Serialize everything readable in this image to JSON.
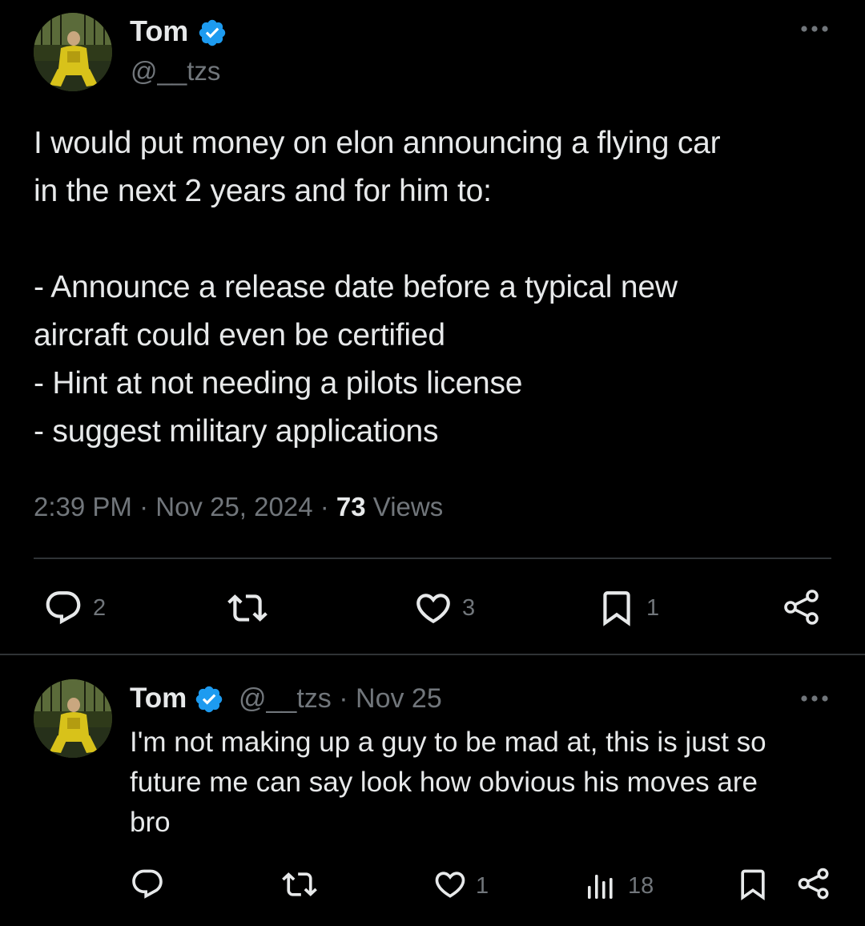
{
  "main_tweet": {
    "author_name": "Tom",
    "author_handle": "@__tzs",
    "more_label": "•••",
    "text": "I would put money on elon announcing a flying car\nin the next 2 years and for him to:\n\n- Announce a release date before a typical new\naircraft could even be certified\n- Hint at not needing a pilots license\n- suggest military applications",
    "time": "2:39 PM",
    "date": "Nov 25, 2024",
    "views_count": "73",
    "views_label": "Views",
    "separator": "·",
    "actions": {
      "replies": "2",
      "retweets": "",
      "likes": "3",
      "bookmarks": "1"
    }
  },
  "reply_tweet": {
    "author_name": "Tom",
    "author_handle": "@__tzs",
    "separator": "·",
    "date": "Nov 25",
    "more_label": "•••",
    "text": "I'm not making up a guy to be mad at, this is just so\nfuture me can say look how obvious his moves are\nbro",
    "actions": {
      "replies": "",
      "retweets": "",
      "likes": "1",
      "views": "18"
    }
  },
  "colors": {
    "background": "#000000",
    "text": "#e7e9ea",
    "secondary": "#71767b",
    "verified": "#1d9bf0",
    "divider": "#2f3336"
  },
  "icons": {
    "verified": "verified-badge-icon",
    "reply": "reply-bubble-icon",
    "retweet": "retweet-icon",
    "like": "heart-icon",
    "bookmark": "bookmark-icon",
    "share": "share-icon",
    "views": "views-chart-icon",
    "more": "more-dots-icon"
  }
}
